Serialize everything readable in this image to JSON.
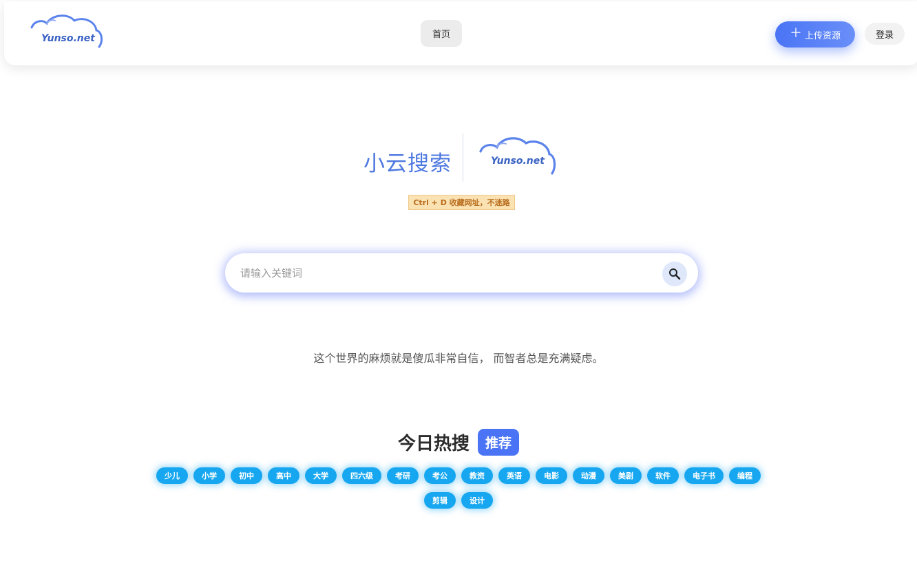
{
  "header": {
    "logo_text": "Yunso.net",
    "nav_home": "首页",
    "upload_label": "上传资源",
    "login_label": "登录"
  },
  "brand": {
    "name_cn": "小云搜索",
    "logo_text": "Yunso.net",
    "hint": "Ctrl + D 收藏网址，不迷路"
  },
  "search": {
    "placeholder": "请输入关键词",
    "value": ""
  },
  "quote": "这个世界的麻烦就是傻瓜非常自信， 而智者总是充满疑虑。",
  "hot": {
    "title": "今日热搜",
    "badge": "推荐",
    "tags": [
      "少儿",
      "小学",
      "初中",
      "高中",
      "大学",
      "四六级",
      "考研",
      "考公",
      "教资",
      "英语",
      "电影",
      "动漫",
      "美剧",
      "软件",
      "电子书",
      "编程",
      "剪辑",
      "设计"
    ]
  },
  "colors": {
    "accent": "#4a74f5",
    "tag": "#17a7f0",
    "hint_bg": "#fbe2b3",
    "hint_text": "#b86d1c"
  },
  "icons": {
    "upload": "plus-icon",
    "search": "magnifier-icon",
    "logo": "cloud-icon"
  }
}
